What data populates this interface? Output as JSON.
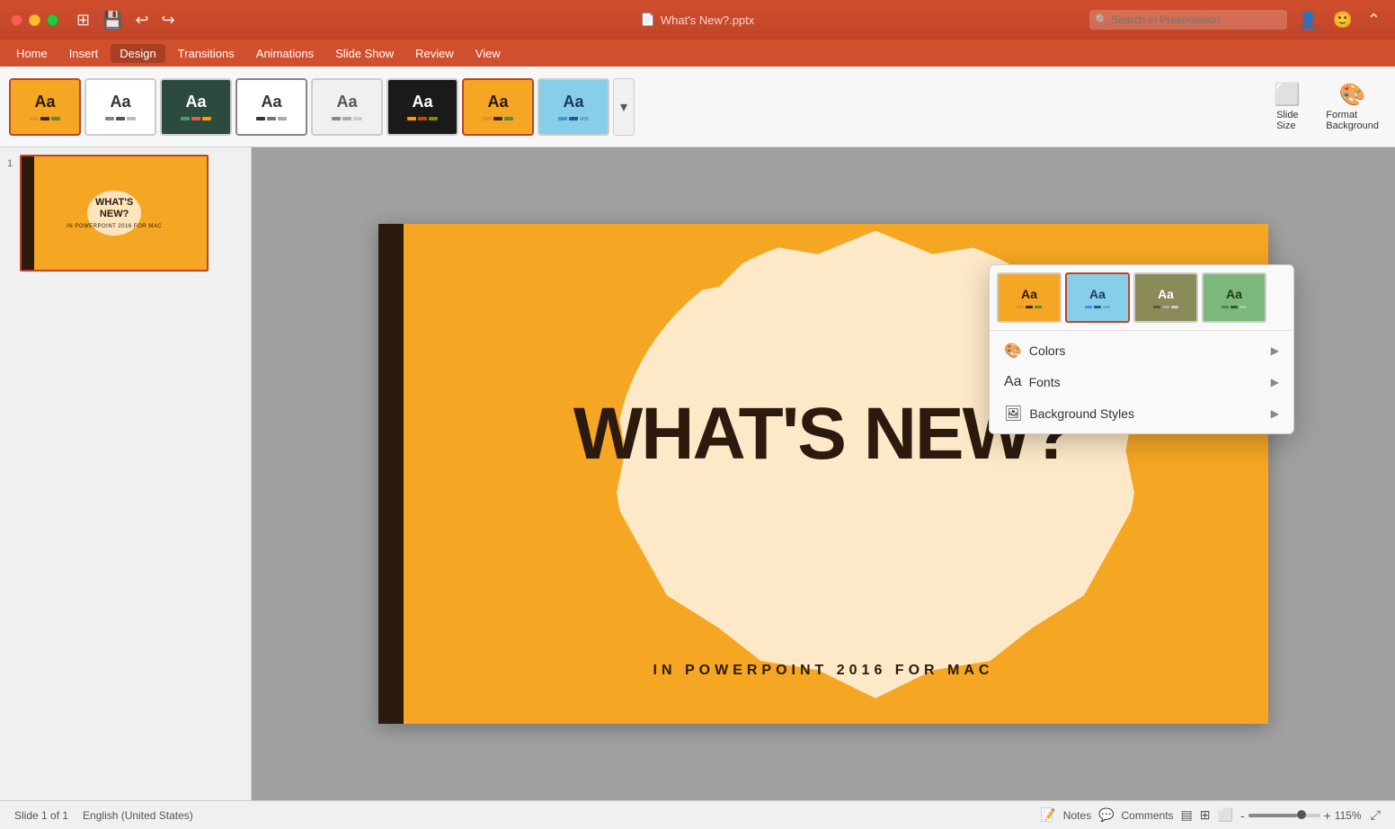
{
  "titleBar": {
    "documentTitle": "What's New?.pptx",
    "searchPlaceholder": "Search in Presentation"
  },
  "menuBar": {
    "items": [
      "Home",
      "Insert",
      "Design",
      "Transitions",
      "Animations",
      "Slide Show",
      "Review",
      "View"
    ]
  },
  "ribbon": {
    "themes": [
      {
        "id": "yellow",
        "label": "Aa",
        "bg": "#f5a623",
        "bars": [
          "#e8912c",
          "#3a2a1a",
          "#5a8a3a"
        ],
        "selected": true
      },
      {
        "id": "white",
        "label": "Aa",
        "bg": "#ffffff",
        "bars": [
          "#888",
          "#555",
          "#bbb"
        ],
        "selected": false
      },
      {
        "id": "dark",
        "label": "Aa",
        "bg": "#2d3748",
        "bars": [
          "#4a6fa5",
          "#e55",
          "#f90"
        ],
        "selected": false
      },
      {
        "id": "frame",
        "label": "Aa",
        "bg": "#ffffff",
        "bars": [
          "#333",
          "#777",
          "#aaa"
        ],
        "selected": false
      },
      {
        "id": "stripe",
        "label": "Aa",
        "bg": "#f5f5f5",
        "bars": [
          "#888",
          "#aaa",
          "#ccc"
        ],
        "selected": false
      },
      {
        "id": "black",
        "label": "Aa",
        "bg": "#1a1a1a",
        "bars": [
          "#f90",
          "#c40",
          "#880"
        ],
        "selected": false
      },
      {
        "id": "orange-sel",
        "label": "Aa",
        "bg": "#f5a623",
        "bars": [
          "#e8912c",
          "#3a2a1a",
          "#5a8a3a"
        ],
        "selected": true
      },
      {
        "id": "blue",
        "label": "Aa",
        "bg": "#87ceeb",
        "bars": [
          "#4a90d9",
          "#2a5a8a",
          "#7ab"
        ],
        "selected": false
      }
    ],
    "expandedThemes": [
      {
        "id": "dd1",
        "bg": "#f5a623"
      },
      {
        "id": "dd2",
        "bg": "#87ceeb"
      },
      {
        "id": "dd3",
        "bg": "#8b8b5a"
      },
      {
        "id": "dd4",
        "bg": "#7cb87c"
      }
    ],
    "slideSizeLabel": "Slide\nSize",
    "formatBackgroundLabel": "Format\nBackground"
  },
  "dropdown": {
    "menuItems": [
      {
        "icon": "🎨",
        "label": "Colors",
        "hasArrow": true
      },
      {
        "icon": "Aa",
        "label": "Fonts",
        "hasArrow": true
      },
      {
        "icon": "🖼",
        "label": "Background Styles",
        "hasArrow": true
      }
    ]
  },
  "slide": {
    "mainTitle": "WHAT'S NEW?",
    "subtitle": "IN POWERPOINT 2016 FOR MAC"
  },
  "statusBar": {
    "slideInfo": "Slide 1 of 1",
    "language": "English (United States)",
    "zoomPercent": "115%"
  }
}
